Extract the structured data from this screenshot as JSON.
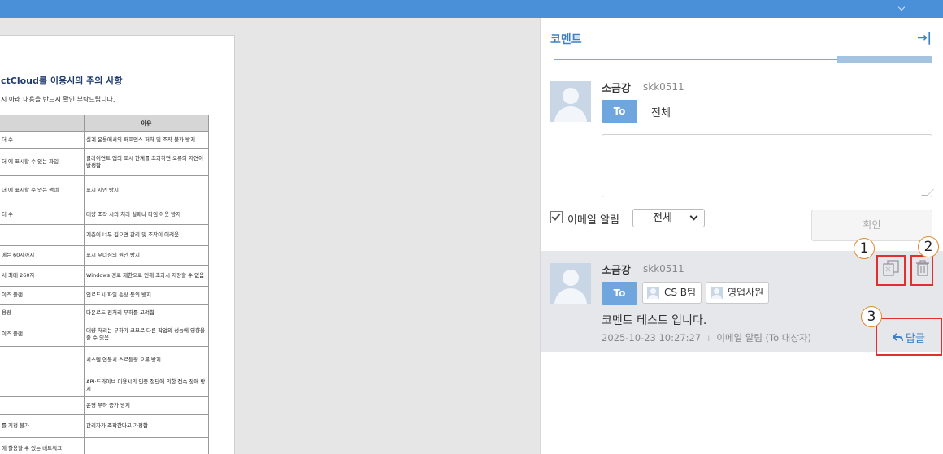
{
  "document": {
    "title": "ctCloud를 이용시의 주의 사항",
    "subtitle": "시 아래 내용을 반드시 확인 부탁드립니다.",
    "table": {
      "headers": [
        "",
        "이유"
      ],
      "rows": [
        [
          "더 수",
          "실계 운용에서의 퍼포먼스 저하 및 조작 불가 방지"
        ],
        [
          "더 에 표시할 수 있는 파일",
          "클라이언트 앱의 표시 한계를 초과하면 오류와 지연이 발생함"
        ],
        [
          "더 에 표시할 수 있는 썸네",
          "표시 지연 방지"
        ],
        [
          "더 수",
          "대량 조작 시의 처리 실패나 타임 아웃 방지"
        ],
        [
          "",
          "계층이 너무 깊으면 관리 및 조작이 어려움"
        ],
        [
          "에는 60자까지",
          "표시 무너짐의 원인 방지"
        ],
        [
          "서 최대 260자",
          "Windows 경로 제한으로 인해 초과시 저장할 수 없음"
        ],
        [
          "이즈 플랜",
          "업로드시 파일 손상 등의 방지"
        ],
        [
          "용량",
          "다운로드 전처리 부하를 고려함"
        ],
        [
          "이즈 플랜",
          "대량 처리는 부하가 크므로 다른 작업의 성능에 영향을 줄 수 있음"
        ],
        [
          "",
          "시스템 연동시 스로틀링 오류 방지"
        ],
        [
          "",
          "API·드라이브 이용시의 인증 절단에 의한 접속 장애 방지"
        ],
        [
          "",
          "운영 부하 증가 방지"
        ],
        [
          "를 지정 불가",
          "관리자가 조작한다고 가정함"
        ],
        [
          "에 활용할 수 있는 네트워크",
          ""
        ]
      ]
    }
  },
  "panel": {
    "title": "코멘트",
    "collapse_icon": "→|",
    "composer": {
      "user_name": "소금강",
      "user_id": "skk0511",
      "to_label": "To",
      "recipient": "전체",
      "input_value": "",
      "email_notify_label": "이메일 알림",
      "email_notify_checked": true,
      "email_select_value": "전체",
      "confirm_label": "확인"
    },
    "comment": {
      "user_name": "소금강",
      "user_id": "skk0511",
      "to_label": "To",
      "recipients": [
        "CS B팀",
        "영업사원"
      ],
      "text": "코멘트 테스트 입니다.",
      "timestamp": "2025-10-23 10:27:27",
      "meta_separator": "ı",
      "notify_info": "이메일 알림 (To 대상자)",
      "reply_label": "답글"
    }
  },
  "annotations": {
    "callouts": [
      "1",
      "2",
      "3"
    ],
    "colors": {
      "box": "#e03030",
      "circle": "#e08a2c"
    }
  },
  "colors": {
    "topbar": "#4a90d9",
    "accent": "#3d80c6",
    "to_button": "#6fa6dd",
    "comment_bg": "#e5e7ea"
  }
}
